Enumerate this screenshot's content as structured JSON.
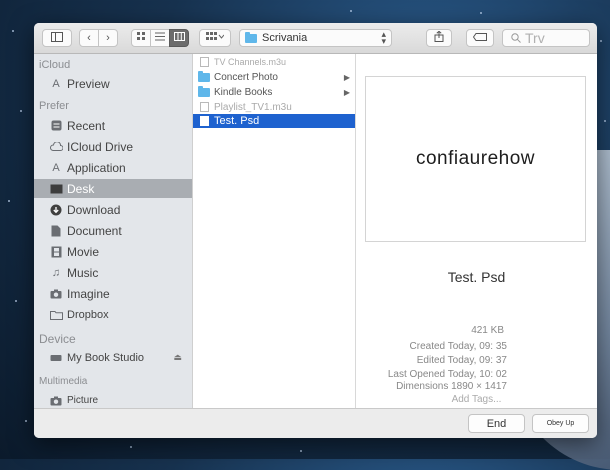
{
  "toolbar": {
    "location": "Scrivania",
    "search_placeholder": "Trv",
    "view_icons": [
      "sidebar-toggle-icon",
      "back-icon",
      "forward-icon",
      "icon-view-icon",
      "list-view-icon",
      "column-view-icon",
      "arrange-icon",
      "share-icon",
      "tag-icon",
      "search-icon"
    ]
  },
  "sidebar": {
    "sections": [
      "iCloud",
      "Prefer",
      "Device",
      "Multimedia"
    ],
    "items": [
      {
        "label": "Preview",
        "icon": "preview-icon"
      },
      {
        "label": "Recent",
        "icon": "recent-icon"
      },
      {
        "label": "ICloud Drive",
        "icon": "cloud-icon"
      },
      {
        "label": "Application",
        "icon": "applications-icon"
      },
      {
        "label": "Desk",
        "icon": "desktop-icon",
        "selected": true
      },
      {
        "label": "Download",
        "icon": "download-icon"
      },
      {
        "label": "Document",
        "icon": "document-icon"
      },
      {
        "label": "Movie",
        "icon": "movie-icon"
      },
      {
        "label": "Music",
        "icon": "music-icon"
      },
      {
        "label": "Imagine",
        "icon": "camera-icon"
      },
      {
        "label": "Dropbox",
        "icon": "folder-icon"
      },
      {
        "label": "My Book Studio",
        "icon": "drive-icon"
      },
      {
        "label": "Picture",
        "icon": "camera-icon"
      }
    ]
  },
  "files": [
    {
      "name": "TV Channels.m3u",
      "type": "file",
      "dim": true
    },
    {
      "name": "Concert Photo",
      "type": "folder"
    },
    {
      "name": "Kindle Books",
      "type": "folder"
    },
    {
      "name": "Playlist_TV1.m3u",
      "type": "file",
      "dim": true
    },
    {
      "name": "Test. Psd",
      "type": "file",
      "selected": true
    }
  ],
  "preview": {
    "thumb_text": "confiaurehow",
    "filename": "Test. Psd",
    "size": "421 KB",
    "created": "Created Today, 09: 35",
    "edited": "Edited Today, 09: 37",
    "last_opened": "Last Opened Today, 10: 02",
    "dimensions": "Dimensions 1890 × 1417",
    "add_tags": "Add Tags..."
  },
  "buttons": {
    "end": "End",
    "open": "Obey Up"
  }
}
